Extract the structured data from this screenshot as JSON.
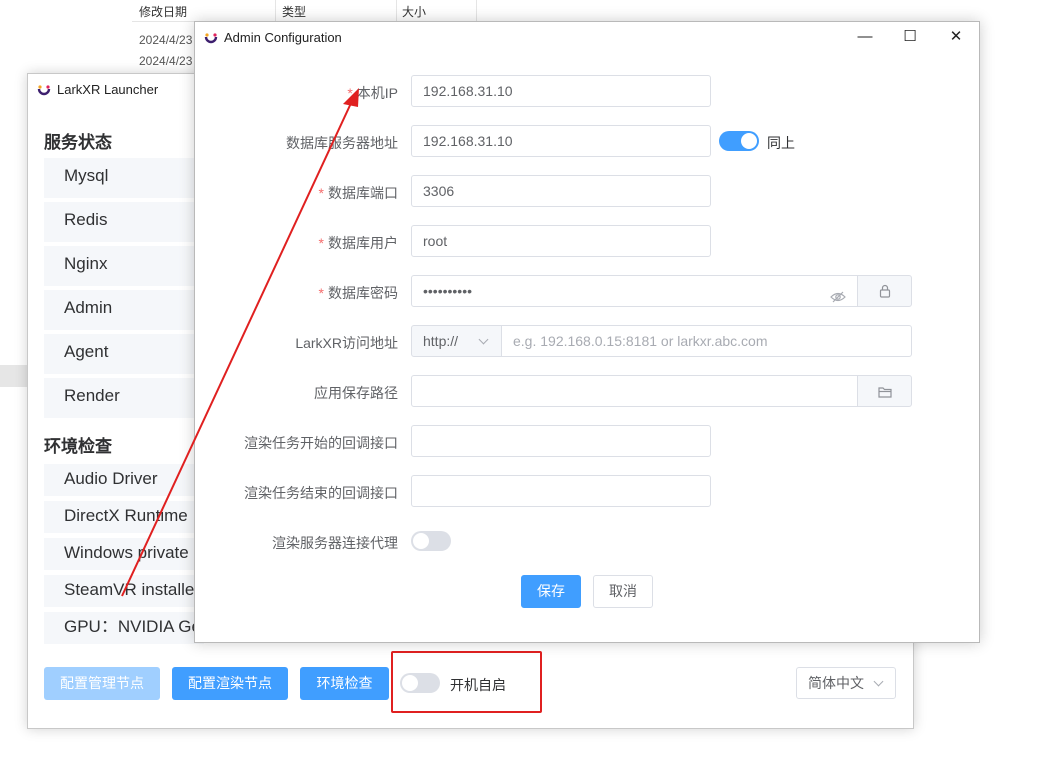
{
  "explorer": {
    "columns": [
      "修改日期",
      "类型",
      "大小"
    ],
    "dates": [
      "2024/4/23",
      "2024/4/23"
    ]
  },
  "launcher": {
    "title": "LarkXR Launcher",
    "service_status_title": "服务状态",
    "services": [
      "Mysql",
      "Redis",
      "Nginx",
      "Admin",
      "Agent",
      "Render"
    ],
    "env_check_title": "环境检查",
    "env_items": [
      "Audio Driver",
      "DirectX Runtime",
      "Windows private",
      "SteamVR installed",
      "GPU：NVIDIA Ge"
    ],
    "buttons": {
      "config_admin": "配置管理节点",
      "config_render": "配置渲染节点",
      "env_check": "环境检查"
    },
    "autostart_label": "开机自启",
    "autostart_enabled": false,
    "language": "简体中文"
  },
  "admin": {
    "title": "Admin Configuration",
    "controls": {
      "minimize": "—",
      "maximize": "☐",
      "close": "✕"
    },
    "fields": {
      "local_ip": {
        "label": "本机IP",
        "required": true,
        "value": "192.168.31.10"
      },
      "db_server": {
        "label": "数据库服务器地址",
        "required": false,
        "value": "192.168.31.10",
        "same_label": "同上",
        "same_enabled": true
      },
      "db_port": {
        "label": "数据库端口",
        "required": true,
        "value": "3306"
      },
      "db_user": {
        "label": "数据库用户",
        "required": true,
        "value": "root"
      },
      "db_password": {
        "label": "数据库密码",
        "required": true,
        "value": "••••••••••"
      },
      "larkxr_url": {
        "label": "LarkXR访问地址",
        "required": false,
        "protocol": "http://",
        "placeholder": "e.g. 192.168.0.15:8181 or larkxr.abc.com"
      },
      "save_path": {
        "label": "应用保存路径",
        "required": false,
        "value": ""
      },
      "render_start_callback": {
        "label": "渲染任务开始的回调接口",
        "required": false,
        "value": ""
      },
      "render_end_callback": {
        "label": "渲染任务结束的回调接口",
        "required": false,
        "value": ""
      },
      "render_proxy": {
        "label": "渲染服务器连接代理",
        "required": false,
        "enabled": false
      }
    },
    "save_label": "保存",
    "cancel_label": "取消"
  },
  "colors": {
    "primary": "#409eff",
    "annotation_red": "#e02020"
  }
}
